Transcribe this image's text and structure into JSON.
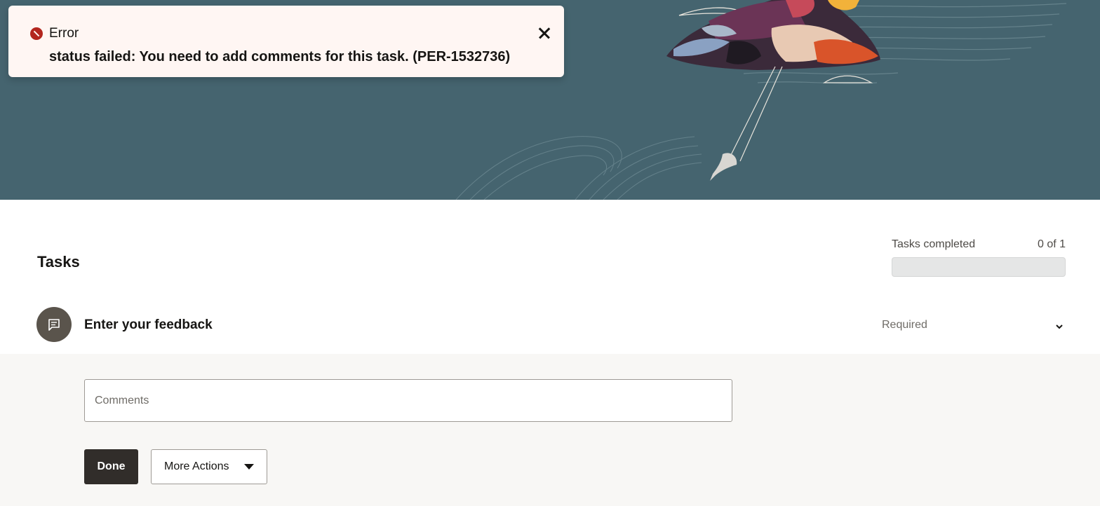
{
  "toast": {
    "title": "Error",
    "message": "status failed: You need to add comments for this task. (PER-1532736)",
    "icon": "error-icon",
    "close_icon": "close-icon",
    "error_color": "#b3261e"
  },
  "tasks": {
    "title": "Tasks",
    "progress_label": "Tasks completed",
    "progress_count": "0 of 1",
    "progress_fraction": 0,
    "items": [
      {
        "name": "Enter your feedback",
        "status": "Required",
        "icon": "feedback-icon",
        "comments_placeholder": "Comments",
        "done_label": "Done",
        "more_actions_label": "More Actions"
      }
    ]
  },
  "colors": {
    "banner": "#45646f",
    "primary_button": "#312d2a",
    "panel_background": "#f8f7f5"
  }
}
